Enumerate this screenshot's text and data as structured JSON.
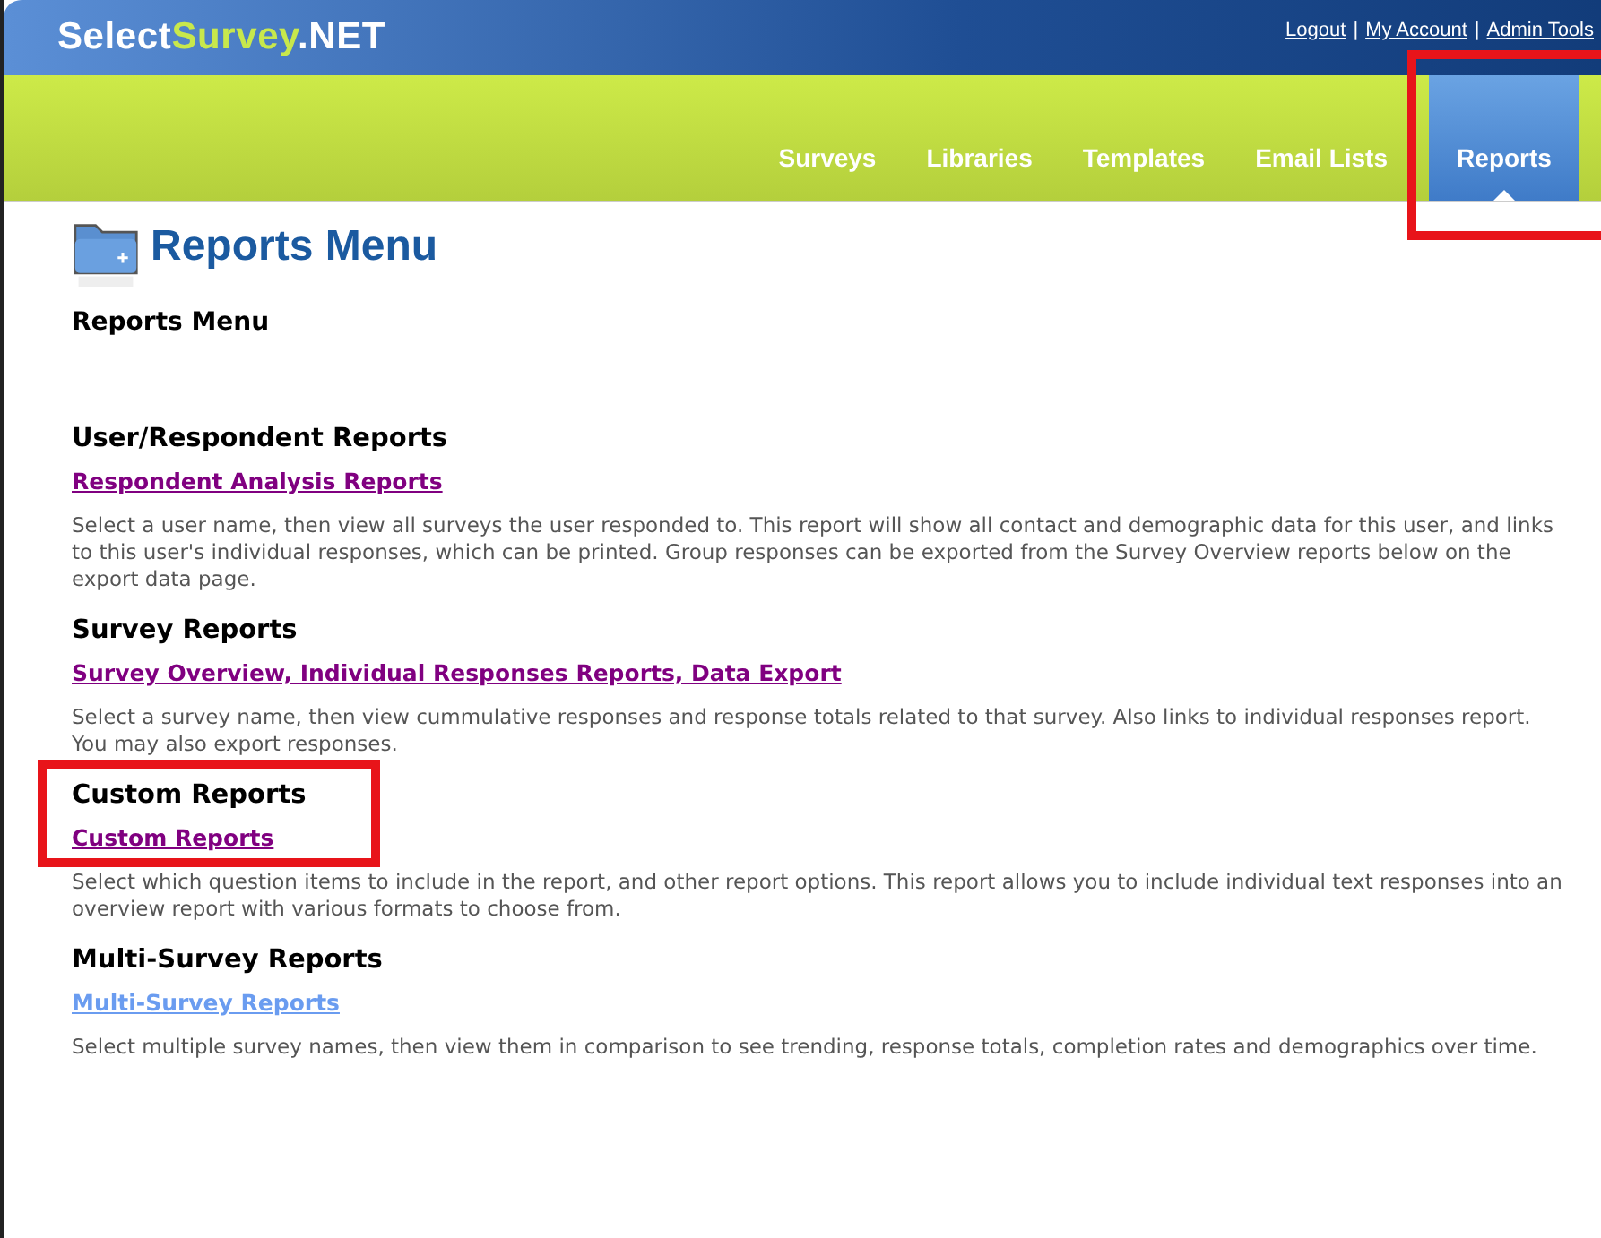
{
  "logo": {
    "part_1": "Select",
    "part_2": "Survey",
    "part_3": ".NET"
  },
  "top_links": [
    "Logout",
    "My Account",
    "Admin Tools"
  ],
  "link_separator": "|",
  "tabs": [
    {
      "label": "Surveys",
      "selected": false,
      "highlighted": false
    },
    {
      "label": "Libraries",
      "selected": false,
      "highlighted": false
    },
    {
      "label": "Templates",
      "selected": false,
      "highlighted": false
    },
    {
      "label": "Email Lists",
      "selected": false,
      "highlighted": false
    },
    {
      "label": "Reports",
      "selected": true,
      "highlighted": true
    }
  ],
  "page_title": "Reports Menu",
  "subtitle": "Reports Menu",
  "sections": [
    {
      "heading": "User/Respondent Reports",
      "link": "Respondent Analysis Reports",
      "visited": true,
      "highlighted": false,
      "description": "Select a user name, then view all surveys the user responded to.  This report will show all contact and demographic data for this user, and links to this user's individual responses, which can be printed.  Group responses can be exported from the Survey Overview reports below on the export data page."
    },
    {
      "heading": "Survey Reports",
      "link": "Survey Overview, Individual Responses Reports, Data Export",
      "visited": true,
      "highlighted": false,
      "description": "Select a survey name, then view cummulative responses and response totals related to that survey.  Also links to individual responses report.  You may also export responses."
    },
    {
      "heading": "Custom Reports",
      "link": "Custom Reports",
      "visited": true,
      "highlighted": true,
      "description": "Select which question items to include in the report, and other report options.  This report allows you to include individual text responses into an overview report with various formats to choose from."
    },
    {
      "heading": "Multi-Survey Reports",
      "link": "Multi-Survey Reports",
      "visited": false,
      "highlighted": false,
      "description": "Select multiple survey names, then view them in comparison to see trending, response totals, completion rates and demographics over time."
    }
  ]
}
